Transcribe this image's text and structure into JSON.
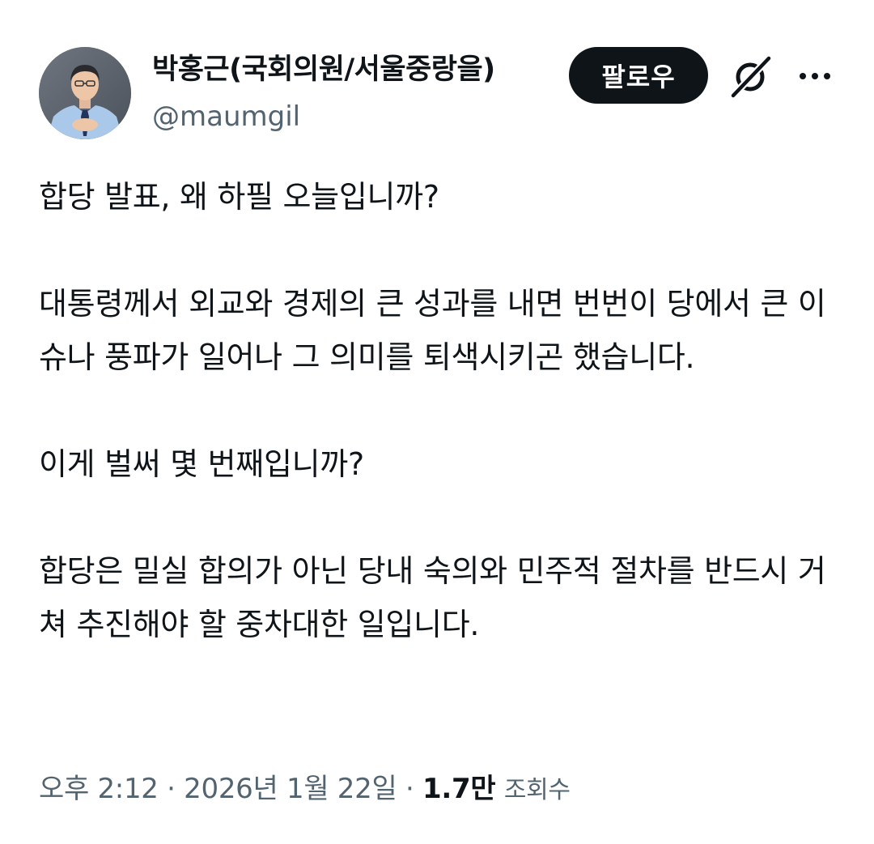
{
  "author": {
    "display_name": "박홍근(국회의원/서울중랑을)",
    "handle": "@maumgil"
  },
  "actions": {
    "follow_label": "팔로우",
    "grok_icon": "grok-icon",
    "more_icon": "more-icon"
  },
  "tweet": {
    "paragraphs": [
      "합당 발표, 왜 하필 오늘입니까?",
      "대통령께서 외교와 경제의 큰 성과를 내면 번번이 당에서 큰 이슈나 풍파가 일어나 그 의미를 퇴색시키곤 했습니다.",
      "이게 벌써 몇 번째입니까?",
      "합당은 밀실 합의가 아닌 당내 숙의와 민주적 절차를 반드시 거쳐 추진해야 할 중차대한 일입니다."
    ]
  },
  "meta": {
    "time": "오후 2:12",
    "date": "2026년 1월 22일",
    "separator": "·",
    "views_count": "1.7만",
    "views_label": "조회수"
  },
  "colors": {
    "text": "#0f1419",
    "secondary": "#536471",
    "button_bg": "#0f1419",
    "button_text": "#ffffff"
  }
}
